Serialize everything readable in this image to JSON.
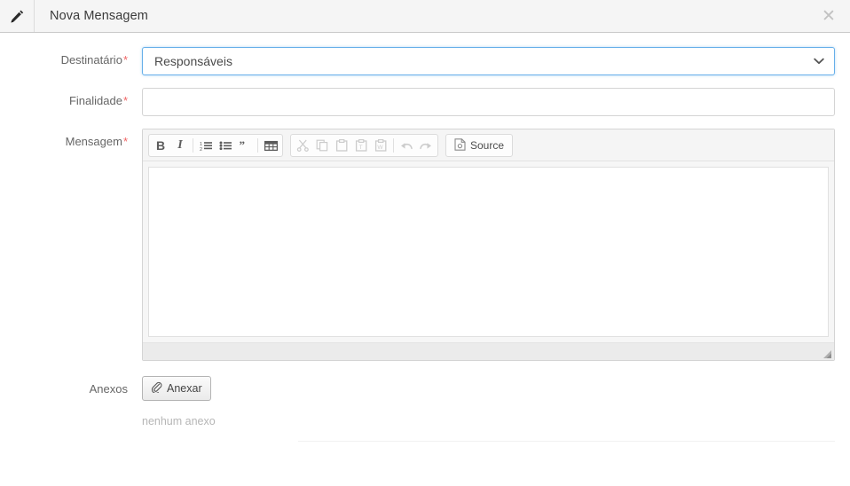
{
  "header": {
    "icon": "pencil-icon",
    "title": "Nova Mensagem",
    "close_label": "✕"
  },
  "form": {
    "recipient": {
      "label": "Destinatário",
      "required_marker": "*",
      "value": "Responsáveis",
      "options": [
        "Responsáveis"
      ],
      "focused": true,
      "focus_color": "#66afe9"
    },
    "purpose": {
      "label": "Finalidade",
      "required_marker": "*",
      "value": "",
      "placeholder": ""
    },
    "message": {
      "label": "Mensagem",
      "required_marker": "*",
      "value": "",
      "toolbar": {
        "group1": [
          {
            "name": "bold-icon",
            "label": "B"
          },
          {
            "name": "italic-icon",
            "label": "I"
          },
          {
            "name": "numbered-list-icon",
            "label": ""
          },
          {
            "name": "bulleted-list-icon",
            "label": ""
          },
          {
            "name": "blockquote-icon",
            "label": "”"
          },
          {
            "name": "table-icon",
            "label": ""
          }
        ],
        "group2": [
          {
            "name": "cut-icon",
            "label": "",
            "disabled": true
          },
          {
            "name": "copy-icon",
            "label": "",
            "disabled": true
          },
          {
            "name": "paste-icon",
            "label": "",
            "disabled": true
          },
          {
            "name": "paste-text-icon",
            "label": "T",
            "disabled": true
          },
          {
            "name": "paste-word-icon",
            "label": "W",
            "disabled": true
          },
          {
            "name": "undo-icon",
            "label": "",
            "disabled": true
          },
          {
            "name": "redo-icon",
            "label": "",
            "disabled": true
          }
        ],
        "source_label": "Source"
      }
    },
    "attachments": {
      "label": "Anexos",
      "button_label": "Anexar",
      "button_icon": "paperclip-icon",
      "empty_text": "nenhum anexo"
    }
  }
}
